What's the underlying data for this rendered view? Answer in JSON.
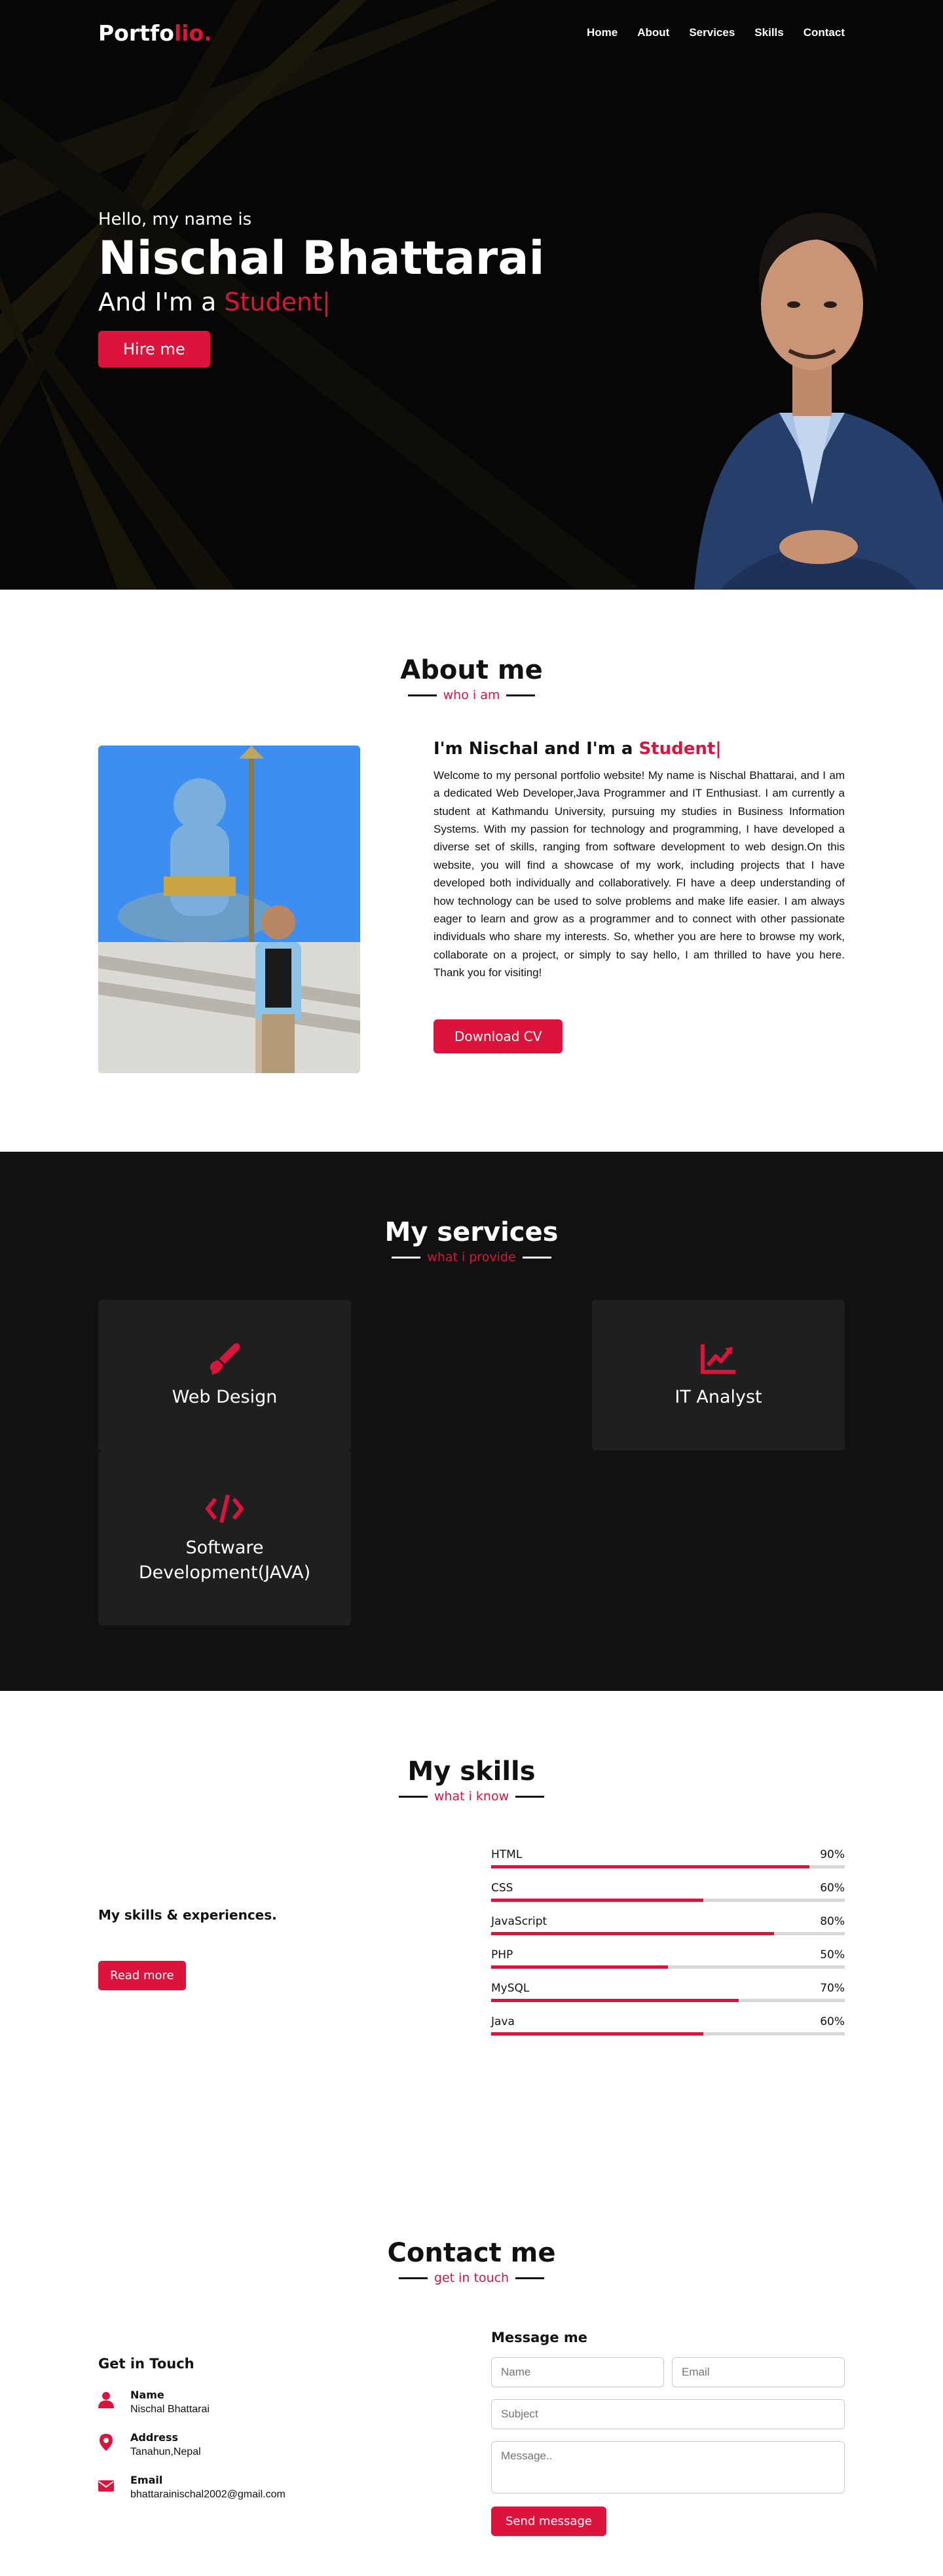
{
  "nav": {
    "logo_main": "Portfo",
    "logo_accent": "lio.",
    "items": [
      {
        "label": "Home"
      },
      {
        "label": "About"
      },
      {
        "label": "Services"
      },
      {
        "label": "Skills"
      },
      {
        "label": "Contact"
      }
    ]
  },
  "hero": {
    "hello": "Hello, my name is",
    "name": "Nischal Bhattarai",
    "role_prefix": "And I'm a ",
    "role_typed": "Student|",
    "cta": "Hire me"
  },
  "about": {
    "title": "About me",
    "subtitle": "who i am",
    "heading_prefix": "I'm Nischal and I'm a ",
    "heading_typed": "Student|",
    "paragraph": "Welcome to my personal portfolio website! My name is Nischal Bhattarai, and I am a dedicated Web Developer,Java Programmer and IT Enthusiast. I am currently a student at Kathmandu University, pursuing my studies in Business Information Systems. With my passion for technology and programming, I have developed a diverse set of skills, ranging from software development to web design.On this website, you will find a showcase of my work, including projects that I have developed both individually and collaboratively. FI have a deep understanding of how technology can be used to solve problems and make life easier. I am always eager to learn and grow as a programmer and to connect with other passionate individuals who share my interests. So, whether you are here to browse my work, collaborate on a project, or simply to say hello, I am thrilled to have you here. Thank you for visiting!",
    "button": "Download CV"
  },
  "services": {
    "title": "My services",
    "subtitle": "what i provide",
    "items": [
      {
        "title": "Web Design",
        "icon": "paintbrush-icon"
      },
      {
        "title": "IT Analyst",
        "icon": "chart-line-icon"
      },
      {
        "title": "Software Development(JAVA)",
        "icon": "code-icon"
      }
    ]
  },
  "skills": {
    "title": "My skills",
    "subtitle": "what i know",
    "left_heading": "My skills & experiences.",
    "button": "Read more",
    "bars": [
      {
        "name": "HTML",
        "percent_label": "90%",
        "value": 90
      },
      {
        "name": "CSS",
        "percent_label": "60%",
        "value": 60
      },
      {
        "name": "JavaScript",
        "percent_label": "80%",
        "value": 80
      },
      {
        "name": "PHP",
        "percent_label": "50%",
        "value": 50
      },
      {
        "name": "MySQL",
        "percent_label": "70%",
        "value": 70
      },
      {
        "name": "Java",
        "percent_label": "60%",
        "value": 60
      }
    ]
  },
  "contact": {
    "title": "Contact me",
    "subtitle": "get in touch",
    "left_heading": "Get in Touch",
    "details": [
      {
        "label": "Name",
        "value": "Nischal Bhattarai",
        "icon": "user-icon"
      },
      {
        "label": "Address",
        "value": "Tanahun,Nepal",
        "icon": "map-marker-icon"
      },
      {
        "label": "Email",
        "value": "bhattarainischal2002@gmail.com",
        "icon": "envelope-icon"
      }
    ],
    "form_heading": "Message me",
    "placeholders": {
      "name": "Name",
      "email": "Email",
      "subject": "Subject",
      "message": "Message.."
    },
    "send": "Send message"
  },
  "colors": {
    "accent": "#dc143c",
    "dark_bg": "#111111",
    "card_bg": "#1f1f1f"
  }
}
